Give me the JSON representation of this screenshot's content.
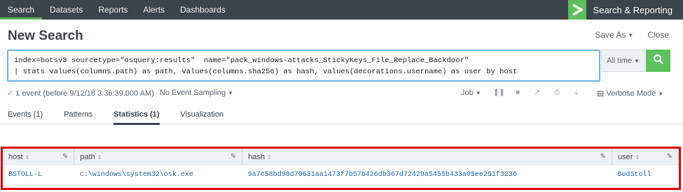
{
  "nav": {
    "tabs": [
      {
        "label": "Search",
        "active": true
      },
      {
        "label": "Datasets"
      },
      {
        "label": "Reports"
      },
      {
        "label": "Alerts"
      },
      {
        "label": "Dashboards"
      }
    ],
    "app_name": "Search & Reporting",
    "logo_icon": "chevron-right-icon"
  },
  "page": {
    "title": "New Search",
    "save_as": "Save As",
    "close": "Close"
  },
  "search": {
    "line1": "index=botsv3 sourcetype=\"osquery:results\"  name=\"pack_windows-attacks_StickyKeys_File_Replace_Backdoor\"",
    "line2": "| stats values(columns.path) as path, values(columns.sha256) as hash, values(decorations.username) as user by host",
    "time_range": "All time",
    "search_icon": "magnifier-icon"
  },
  "status": {
    "events_text": "1 event (before 9/12/18 3:36:39.000 AM)",
    "sampling": "No Event Sampling",
    "job": "Job",
    "verbose_mode": "Verbose Mode"
  },
  "tabs": [
    {
      "label": "Events (1)"
    },
    {
      "label": "Patterns"
    },
    {
      "label": "Statistics (1)",
      "active": true
    },
    {
      "label": "Visualization"
    }
  ],
  "table": {
    "columns": [
      "host",
      "path",
      "hash",
      "user"
    ],
    "rows": [
      [
        "BSTOLL-L",
        "c:\\windows\\system32\\osk.exe",
        "9a7c58bd98d70631aa1473f7b57b426db367d72429a5455b433a05ee251f3236",
        "BudStoll"
      ]
    ]
  },
  "colors": {
    "nav_bg": "#3c444d",
    "accent_green": "#5cc05c",
    "link_blue": "#1a66b7",
    "highlight_red": "#e00000"
  }
}
